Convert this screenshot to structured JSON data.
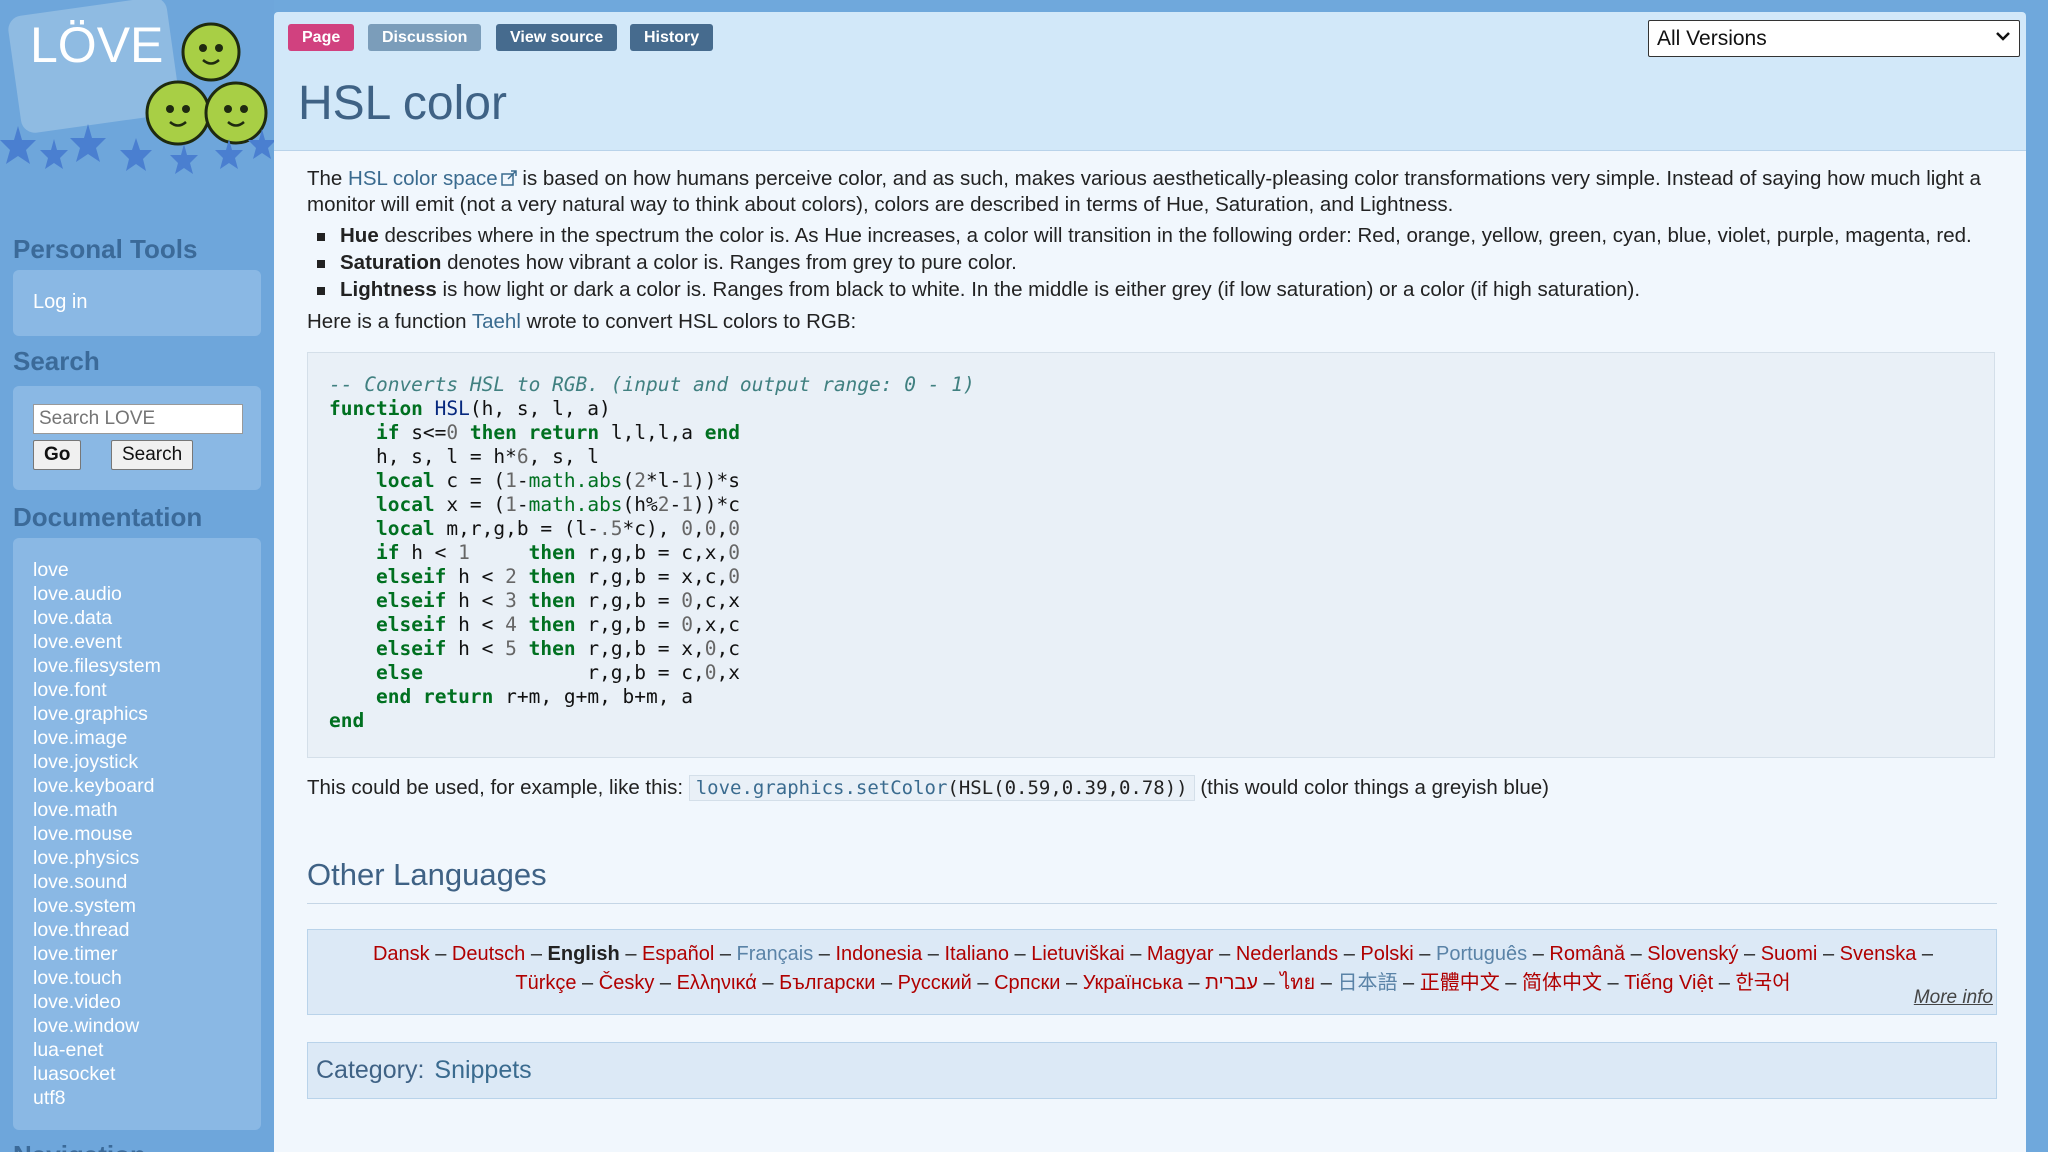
{
  "logo": {
    "text": "LÖVE"
  },
  "sidebar": {
    "personal_tools": {
      "heading": "Personal Tools",
      "login": "Log in"
    },
    "search": {
      "heading": "Search",
      "placeholder": "Search LOVE",
      "go_label": "Go",
      "search_label": "Search"
    },
    "documentation": {
      "heading": "Documentation",
      "items": [
        "love",
        "love.audio",
        "love.data",
        "love.event",
        "love.filesystem",
        "love.font",
        "love.graphics",
        "love.image",
        "love.joystick",
        "love.keyboard",
        "love.math",
        "love.mouse",
        "love.physics",
        "love.sound",
        "love.system",
        "love.thread",
        "love.timer",
        "love.touch",
        "love.video",
        "love.window",
        "lua-enet",
        "luasocket",
        "utf8"
      ]
    },
    "navigation": {
      "heading": "Navigation"
    }
  },
  "tabs": {
    "page": "Page",
    "discussion": "Discussion",
    "view_source": "View source",
    "history": "History"
  },
  "version_select": {
    "selected": "All Versions"
  },
  "page": {
    "title": "HSL color",
    "intro": {
      "the": "The",
      "link": "HSL color space",
      "rest": "is based on how humans perceive color, and as such, makes various aesthetically-pleasing color transformations very simple. Instead of saying how much light a monitor will emit (not a very natural way to think about colors), colors are described in terms of Hue, Saturation, and Lightness."
    },
    "properties": [
      {
        "term": "Hue",
        "desc": "describes where in the spectrum the color is. As Hue increases, a color will transition in the following order: Red, orange, yellow, green, cyan, blue, violet, purple, magenta, red."
      },
      {
        "term": "Saturation",
        "desc": "denotes how vibrant a color is. Ranges from grey to pure color."
      },
      {
        "term": "Lightness",
        "desc": "is how light or dark a color is. Ranges from black to white. In the middle is either grey (if low saturation) or a color (if high saturation)."
      }
    ],
    "function_intro": {
      "before": "Here is a function",
      "author": "Taehl",
      "after": "wrote to convert HSL colors to RGB:"
    },
    "code_lines": [
      "-- Converts HSL to RGB. (input and output range: 0 - 1)",
      "function HSL(h, s, l, a)",
      "    if s<=0 then return l,l,l,a end",
      "    h, s, l = h*6, s, l",
      "    local c = (1-math.abs(2*l-1))*s",
      "    local x = (1-math.abs(h%2-1))*c",
      "    local m,r,g,b = (l-.5*c), 0,0,0",
      "    if h < 1     then r,g,b = c,x,0",
      "    elseif h < 2 then r,g,b = x,c,0",
      "    elseif h < 3 then r,g,b = 0,c,x",
      "    elseif h < 4 then r,g,b = 0,x,c",
      "    elseif h < 5 then r,g,b = x,0,c",
      "    else              r,g,b = c,0,x",
      "    end return r+m, g+m, b+m, a",
      "end"
    ],
    "usage": {
      "before": "This could be used, for example, like this:",
      "code_fn": "love.graphics.setColor",
      "code_args": "(HSL(0.59,0.39,0.78))",
      "after": "(this would color things a greyish blue)"
    },
    "other_languages": {
      "heading": "Other Languages",
      "line1": [
        "Dansk",
        "Deutsch",
        "English",
        "Español",
        "Français",
        "Indonesia",
        "Italiano",
        "Lietuviškai",
        "Magyar",
        "Nederlands",
        "Polski",
        "Português",
        "Română",
        "Slovenský",
        "Suomi",
        "Svenska"
      ],
      "line2": [
        "Türkçe",
        "Česky",
        "Ελληνικά",
        "Български",
        "Русский",
        "Српски",
        "Українська",
        "עברית",
        "ไทย",
        "日本語",
        "正體中文",
        "简体中文",
        "Tiếng Việt",
        "한국어"
      ],
      "current": "English",
      "unwritten": [
        "Français",
        "Português",
        "日本語"
      ],
      "more_info": "More info"
    },
    "category": {
      "label": "Category:",
      "value": "Snippets"
    }
  },
  "colors": {
    "sidebar_bg": "#6ea6db",
    "sidebar_box": "#8ab8e4",
    "tab_active": "#d1417f",
    "tab_inactive": "#466b8e",
    "link": "#3a6b8f",
    "lang_link": "#b00000",
    "content_bg": "#f1f7fd"
  }
}
